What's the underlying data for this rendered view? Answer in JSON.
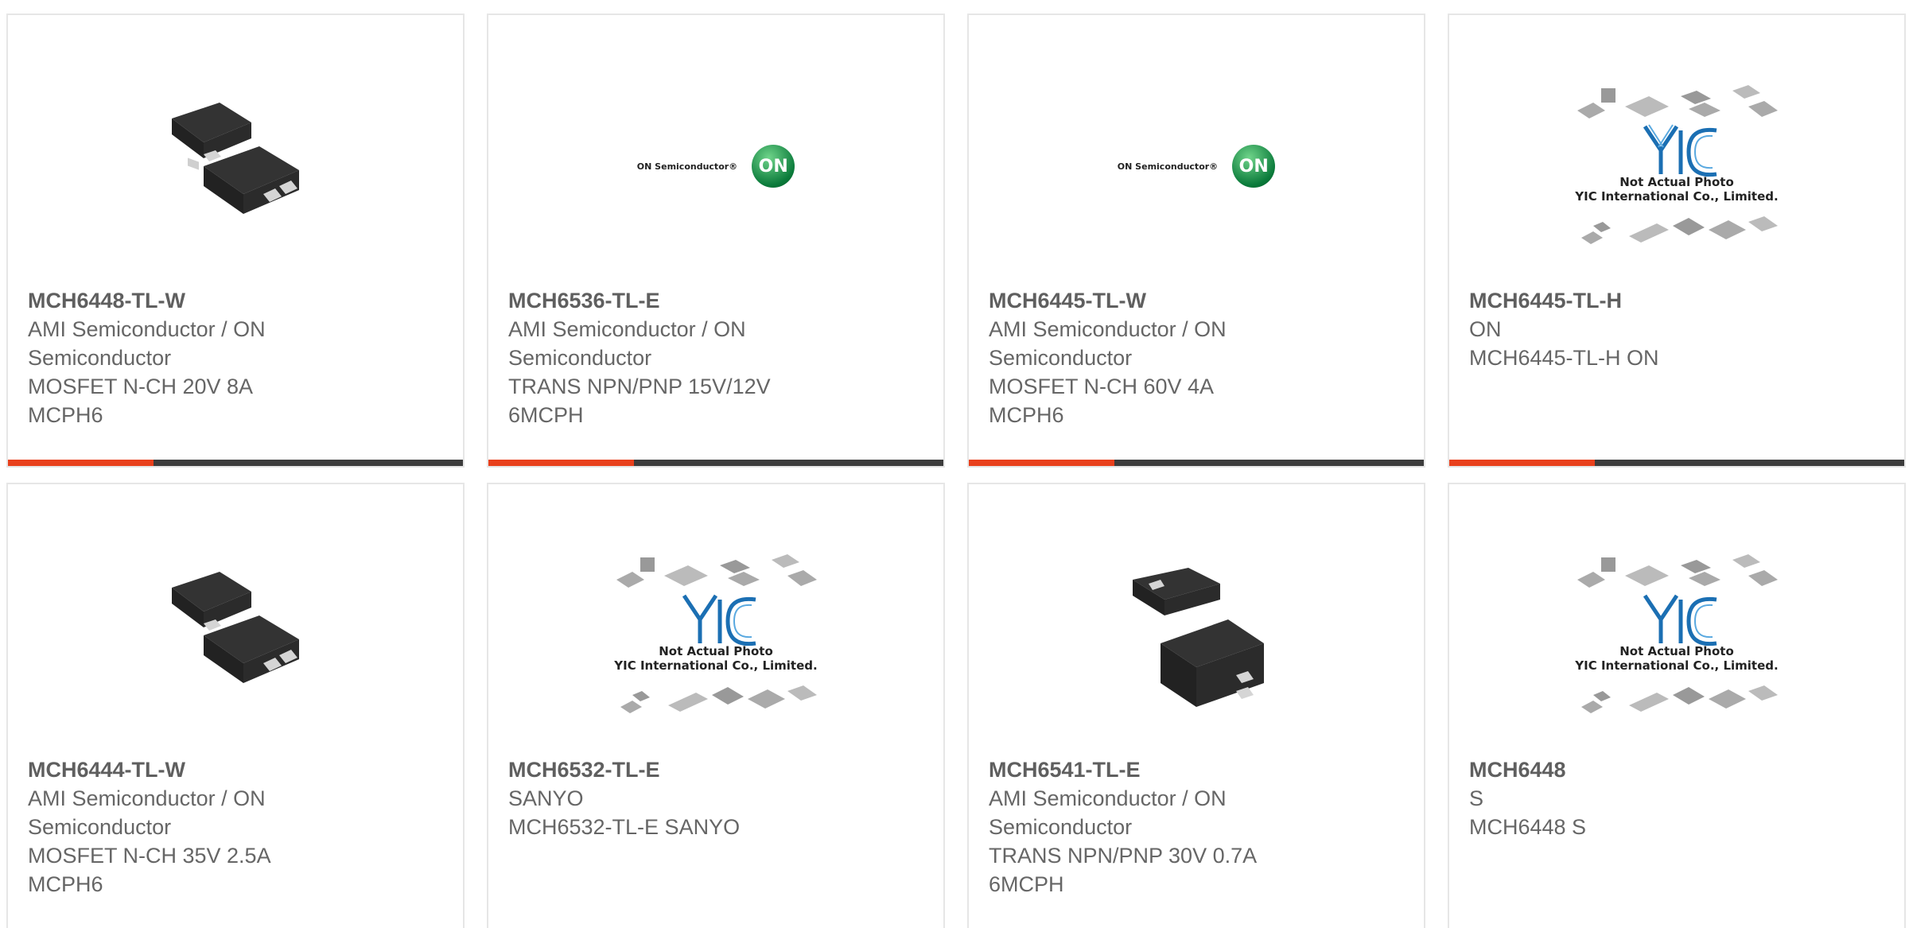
{
  "products": [
    {
      "part_number": "MCH6448-TL-W",
      "manufacturer_line1": "AMI Semiconductor / ON",
      "manufacturer_line2": "Semiconductor",
      "description": "MOSFET N-CH 20V 8A MCPH6",
      "image": "ic-package-photo"
    },
    {
      "part_number": "MCH6536-TL-E",
      "manufacturer_line1": "AMI Semiconductor / ON",
      "manufacturer_line2": "Semiconductor",
      "description": "TRANS NPN/PNP 15V/12V 6MCPH",
      "image": "on-semiconductor-logo"
    },
    {
      "part_number": "MCH6445-TL-W",
      "manufacturer_line1": "AMI Semiconductor / ON",
      "manufacturer_line2": "Semiconductor",
      "description": "MOSFET N-CH 60V 4A MCPH6",
      "image": "on-semiconductor-logo"
    },
    {
      "part_number": "MCH6445-TL-H",
      "manufacturer_line1": "ON",
      "manufacturer_line2": "",
      "description": "MCH6445-TL-H ON",
      "image": "yic-placeholder"
    },
    {
      "part_number": "MCH6444-TL-W",
      "manufacturer_line1": "AMI Semiconductor / ON",
      "manufacturer_line2": "Semiconductor",
      "description": "MOSFET N-CH 35V 2.5A MCPH6",
      "image": "ic-package-photo"
    },
    {
      "part_number": "MCH6532-TL-E",
      "manufacturer_line1": "SANYO",
      "manufacturer_line2": "",
      "description": "MCH6532-TL-E SANYO",
      "image": "yic-placeholder"
    },
    {
      "part_number": "MCH6541-TL-E",
      "manufacturer_line1": "AMI Semiconductor / ON",
      "manufacturer_line2": "Semiconductor",
      "description": "TRANS NPN/PNP 30V 0.7A 6MCPH",
      "image": "ic-package-photo-alt"
    },
    {
      "part_number": "MCH6448",
      "manufacturer_line1": "S",
      "manufacturer_line2": "",
      "description": "MCH6448 S",
      "image": "yic-placeholder"
    }
  ],
  "logos": {
    "on_text": "ON Semiconductor®",
    "on_mark": "ON",
    "yic_note": "Not Actual Photo",
    "yic_company": "YIC International Co., Limited."
  },
  "colors": {
    "accent": "#e8401c",
    "bar": "#3c3c3c",
    "text": "#666666"
  }
}
